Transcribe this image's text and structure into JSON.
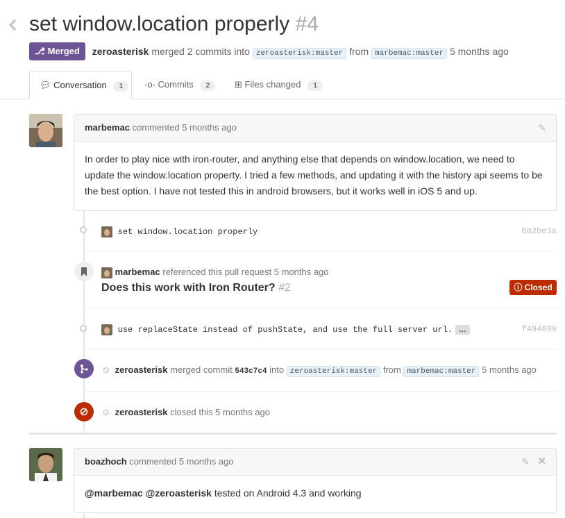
{
  "title": {
    "text": "set window.location properly",
    "number": "#4"
  },
  "header_meta": {
    "state_label": "Merged",
    "author": "zeroasterisk",
    "action": "merged 2 commits into",
    "base_ref": "zeroasterisk:master",
    "from_word": "from",
    "head_ref": "marbemac:master",
    "time": "5 months ago"
  },
  "tabs": [
    {
      "label": "Conversation",
      "count": "1"
    },
    {
      "label": "Commits",
      "count": "2"
    },
    {
      "label": "Files changed",
      "count": "1"
    }
  ],
  "comment1": {
    "author": "marbemac",
    "meta": "commented 5 months ago",
    "body": "In order to play nice with iron-router, and anything else that depends on window.location, we need to update the window.location property. I tried a few methods, and updating it with the history api seems to be the best option. I have not tested this in android browsers, but it works well in iOS 5 and up."
  },
  "commit1": {
    "message": "set window.location properly",
    "sha": "b82be3a"
  },
  "reference": {
    "author": "marbemac",
    "meta": "referenced this pull request 5 months ago",
    "title": "Does this work with Iron Router?",
    "number": "#2",
    "state": "Closed"
  },
  "commit2": {
    "message": "use replaceState instead of pushState, and use the full server url.",
    "ellipsis": "…",
    "sha": "f494898"
  },
  "merge_event": {
    "author": "zeroasterisk",
    "action": "merged commit",
    "sha": "543c7c4",
    "into": "into",
    "base_ref": "zeroasterisk:master",
    "from_word": "from",
    "head_ref": "marbemac:master",
    "time": "5 months ago"
  },
  "close_event": {
    "author": "zeroasterisk",
    "meta": "closed this 5 months ago"
  },
  "comment2": {
    "author": "boazhoch",
    "meta": "commented 5 months ago",
    "mention1": "@marbemac",
    "mention2": "@zeroasterisk",
    "body": "tested on Android 4.3 and working"
  },
  "colors": {
    "merged": "#6e5494",
    "closed": "#bd2c00",
    "link": "#4183c4"
  }
}
